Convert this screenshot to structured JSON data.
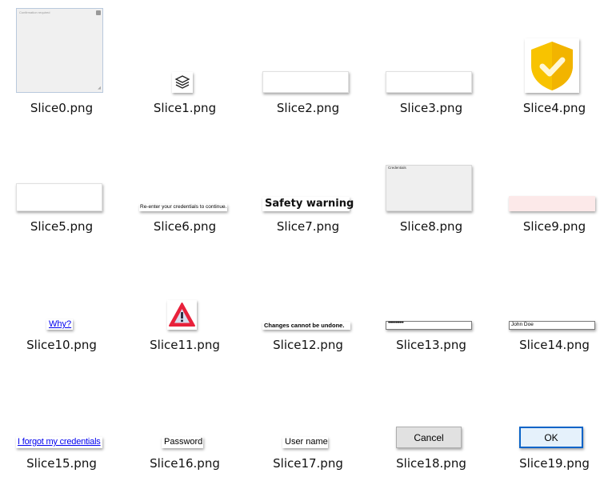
{
  "tiles": [
    {
      "file": "Slice0.png",
      "inner_text": "Confirmation required"
    },
    {
      "file": "Slice1.png",
      "icon": "stacked-layers-icon"
    },
    {
      "file": "Slice2.png"
    },
    {
      "file": "Slice3.png"
    },
    {
      "file": "Slice4.png",
      "icon": "shield-check-icon"
    },
    {
      "file": "Slice5.png"
    },
    {
      "file": "Slice6.png",
      "text": "Re-enter your credentials to continue."
    },
    {
      "file": "Slice7.png",
      "text": "Safety warning"
    },
    {
      "file": "Slice8.png",
      "text": "Credentials"
    },
    {
      "file": "Slice9.png"
    },
    {
      "file": "Slice10.png",
      "text": "Why?"
    },
    {
      "file": "Slice11.png",
      "icon": "warning-triangle-icon"
    },
    {
      "file": "Slice12.png",
      "text": "Changes cannot be undone."
    },
    {
      "file": "Slice13.png",
      "value": "••••••••••••"
    },
    {
      "file": "Slice14.png",
      "value": "John Doe"
    },
    {
      "file": "Slice15.png",
      "text": "I forgot my credentials"
    },
    {
      "file": "Slice16.png",
      "text": "Password"
    },
    {
      "file": "Slice17.png",
      "text": "User name"
    },
    {
      "file": "Slice18.png",
      "text": "Cancel"
    },
    {
      "file": "Slice19.png",
      "text": "OK"
    }
  ],
  "colors": {
    "shield": "#f8c300",
    "shield_dark": "#e0a800",
    "warning_red": "#e8213b",
    "panel_gray": "#efefef",
    "pink_bar": "#fce9e9",
    "ok_border": "#0a64c8"
  }
}
